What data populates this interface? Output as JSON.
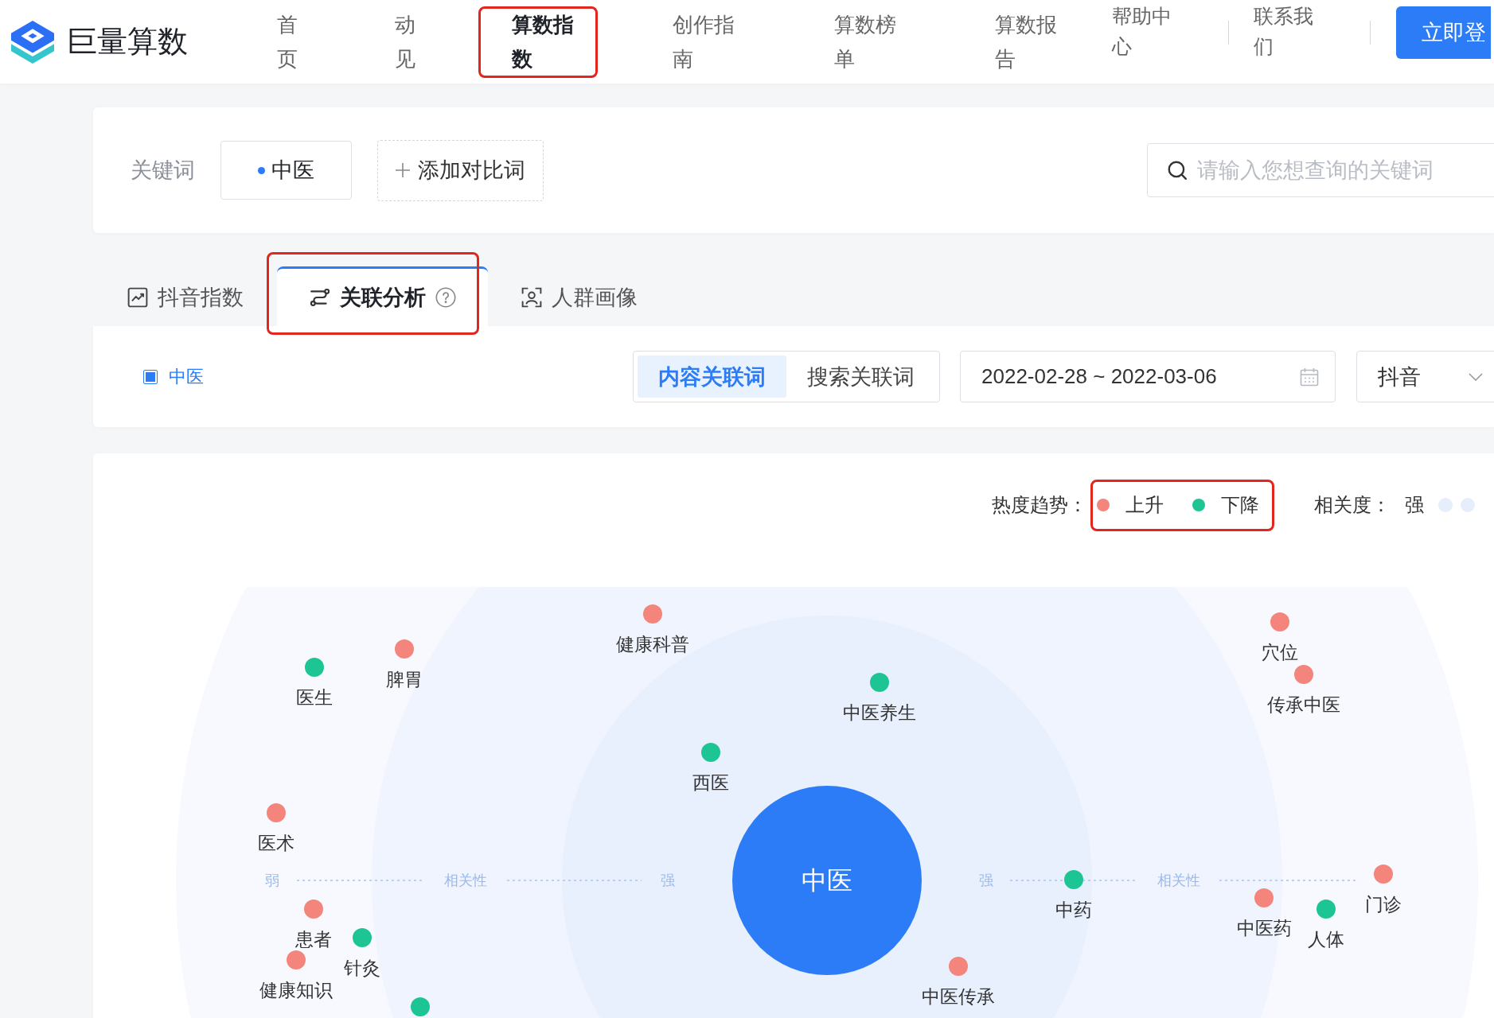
{
  "header": {
    "logo_text": "巨量算数",
    "nav": [
      {
        "label": "首页",
        "selected": false,
        "highlighted": false
      },
      {
        "label": "动见",
        "selected": false,
        "highlighted": false
      },
      {
        "label": "算数指数",
        "selected": true,
        "highlighted": true
      },
      {
        "label": "创作指南",
        "selected": false,
        "highlighted": false
      },
      {
        "label": "算数榜单",
        "selected": false,
        "highlighted": false
      },
      {
        "label": "算数报告",
        "selected": false,
        "highlighted": false
      }
    ],
    "links": [
      "帮助中心",
      "联系我们"
    ],
    "login_button": "立即登"
  },
  "keyword_bar": {
    "label": "关键词",
    "keywords": [
      "中医"
    ],
    "add_button": "添加对比词",
    "search": {
      "placeholder": "请输入您想查询的关键词"
    }
  },
  "tabs": [
    {
      "label": "抖音指数",
      "selected": false,
      "highlighted": false,
      "help": false
    },
    {
      "label": "关联分析",
      "selected": true,
      "highlighted": true,
      "help": true
    },
    {
      "label": "人群画像",
      "selected": false,
      "highlighted": false,
      "help": false
    }
  ],
  "filter": {
    "keyword": {
      "label": "中医",
      "checked": true
    },
    "relation_types": [
      {
        "label": "内容关联词",
        "selected": true
      },
      {
        "label": "搜索关联词",
        "selected": false
      }
    ],
    "date_range": "2022-02-28 ~ 2022-03-06",
    "platform": "抖音"
  },
  "chart": {
    "legend": {
      "trend_title": "热度趋势：",
      "trends": [
        {
          "label": "上升",
          "color": "#f4857c"
        },
        {
          "label": "下降",
          "color": "#1dc595"
        }
      ],
      "highlighted": true,
      "relevance_title": "相关度：",
      "relevance_text": "强"
    },
    "center": "中医",
    "axis_left": [
      "弱",
      "相关性",
      "强"
    ],
    "axis_right": [
      "强",
      "相关性"
    ],
    "nodes": [
      {
        "label": "健康科普",
        "color": "#f4857c"
      },
      {
        "label": "穴位",
        "color": "#f4857c"
      },
      {
        "label": "医生",
        "color": "#1dc595"
      },
      {
        "label": "脾胃",
        "color": "#f4857c"
      },
      {
        "label": "中医养生",
        "color": "#1dc595"
      },
      {
        "label": "传承中医",
        "color": "#f4857c"
      },
      {
        "label": "西医",
        "color": "#1dc595"
      },
      {
        "label": "医术",
        "color": "#f4857c"
      },
      {
        "label": "中药",
        "color": "#1dc595"
      },
      {
        "label": "门诊",
        "color": "#f4857c"
      },
      {
        "label": "患者",
        "color": "#f4857c"
      },
      {
        "label": "中医药",
        "color": "#f4857c"
      },
      {
        "label": "人体",
        "color": "#1dc595"
      },
      {
        "label": "针灸",
        "color": "#1dc595"
      },
      {
        "label": "健康知识",
        "color": "#f4857c"
      },
      {
        "color": "#1dc595"
      },
      {
        "label": "中医传承",
        "color": "#f4857c"
      }
    ]
  }
}
